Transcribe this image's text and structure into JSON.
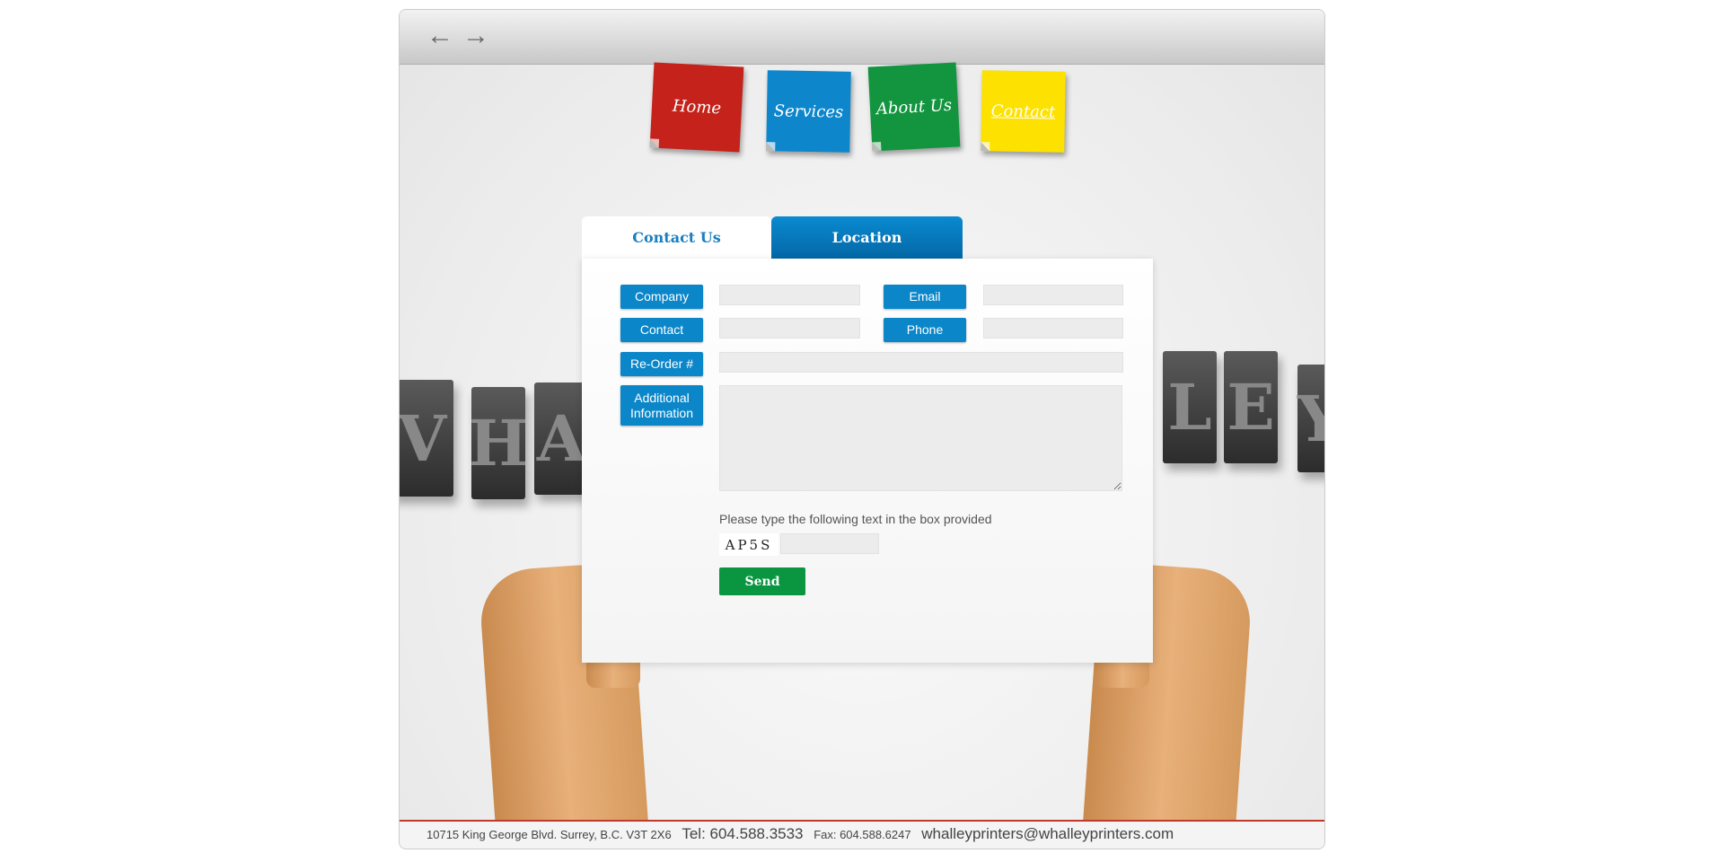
{
  "browser": {
    "back_icon": "arrow-left",
    "forward_icon": "arrow-right",
    "back": "←",
    "forward": "→"
  },
  "nav": [
    {
      "label": "Home",
      "color": "#c4221a"
    },
    {
      "label": "Services",
      "color": "#0d86cc"
    },
    {
      "label": "About Us",
      "color": "#13953f"
    },
    {
      "label": "Contact",
      "color": "#fde100"
    }
  ],
  "background_letters": [
    "V",
    "H",
    "A",
    "L",
    "E",
    "Y"
  ],
  "tabs": [
    {
      "label": "Contact Us",
      "active": true
    },
    {
      "label": "Location",
      "active": false
    }
  ],
  "form": {
    "company": "Company",
    "email": "Email",
    "contact": "Contact",
    "phone": "Phone",
    "reorder": "Re-Order #",
    "additional": "Additional Information",
    "captcha_prompt": "Please type the following text in the box provided",
    "captcha_text": "AP5S",
    "send": "Send"
  },
  "footer": {
    "address": "10715 King George Blvd. Surrey, B.C. V3T 2X6",
    "tel": "Tel: 604.588.3533",
    "fax": "Fax: 604.588.6247",
    "email": "whalleyprinters@whalleyprinters.com"
  }
}
